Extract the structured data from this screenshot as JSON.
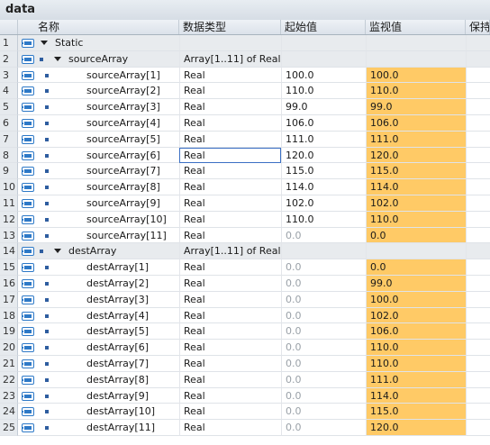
{
  "window": {
    "title": "data"
  },
  "columns": {
    "name": "名称",
    "type": "数据类型",
    "start": "起始值",
    "monitor": "监视值",
    "retain": "保持"
  },
  "rows": [
    {
      "num": "1",
      "name": "Static",
      "level": 0,
      "expand": true,
      "type": "",
      "start": "",
      "monitor": "",
      "grey": true
    },
    {
      "num": "2",
      "name": "sourceArray",
      "level": 1,
      "expand": true,
      "type": "Array[1..11] of Real",
      "start": "",
      "monitor": "",
      "grey": true
    },
    {
      "num": "3",
      "name": "sourceArray[1]",
      "level": 2,
      "type": "Real",
      "start": "100.0",
      "monitor": "100.0"
    },
    {
      "num": "4",
      "name": "sourceArray[2]",
      "level": 2,
      "type": "Real",
      "start": "110.0",
      "monitor": "110.0"
    },
    {
      "num": "5",
      "name": "sourceArray[3]",
      "level": 2,
      "type": "Real",
      "start": "99.0",
      "monitor": "99.0"
    },
    {
      "num": "6",
      "name": "sourceArray[4]",
      "level": 2,
      "type": "Real",
      "start": "106.0",
      "monitor": "106.0"
    },
    {
      "num": "7",
      "name": "sourceArray[5]",
      "level": 2,
      "type": "Real",
      "start": "111.0",
      "monitor": "111.0"
    },
    {
      "num": "8",
      "name": "sourceArray[6]",
      "level": 2,
      "type": "Real",
      "start": "120.0",
      "monitor": "120.0",
      "selected": true
    },
    {
      "num": "9",
      "name": "sourceArray[7]",
      "level": 2,
      "type": "Real",
      "start": "115.0",
      "monitor": "115.0"
    },
    {
      "num": "10",
      "name": "sourceArray[8]",
      "level": 2,
      "type": "Real",
      "start": "114.0",
      "monitor": "114.0"
    },
    {
      "num": "11",
      "name": "sourceArray[9]",
      "level": 2,
      "type": "Real",
      "start": "102.0",
      "monitor": "102.0"
    },
    {
      "num": "12",
      "name": "sourceArray[10]",
      "level": 2,
      "type": "Real",
      "start": "110.0",
      "monitor": "110.0"
    },
    {
      "num": "13",
      "name": "sourceArray[11]",
      "level": 2,
      "type": "Real",
      "start": "0.0",
      "monitor": "0.0",
      "dimStart": true
    },
    {
      "num": "14",
      "name": "destArray",
      "level": 1,
      "expand": true,
      "type": "Array[1..11] of Real",
      "start": "",
      "monitor": "",
      "grey": true
    },
    {
      "num": "15",
      "name": "destArray[1]",
      "level": 2,
      "type": "Real",
      "start": "0.0",
      "monitor": "0.0",
      "dimStart": true
    },
    {
      "num": "16",
      "name": "destArray[2]",
      "level": 2,
      "type": "Real",
      "start": "0.0",
      "monitor": "99.0",
      "dimStart": true
    },
    {
      "num": "17",
      "name": "destArray[3]",
      "level": 2,
      "type": "Real",
      "start": "0.0",
      "monitor": "100.0",
      "dimStart": true
    },
    {
      "num": "18",
      "name": "destArray[4]",
      "level": 2,
      "type": "Real",
      "start": "0.0",
      "monitor": "102.0",
      "dimStart": true
    },
    {
      "num": "19",
      "name": "destArray[5]",
      "level": 2,
      "type": "Real",
      "start": "0.0",
      "monitor": "106.0",
      "dimStart": true
    },
    {
      "num": "20",
      "name": "destArray[6]",
      "level": 2,
      "type": "Real",
      "start": "0.0",
      "monitor": "110.0",
      "dimStart": true
    },
    {
      "num": "21",
      "name": "destArray[7]",
      "level": 2,
      "type": "Real",
      "start": "0.0",
      "monitor": "110.0",
      "dimStart": true
    },
    {
      "num": "22",
      "name": "destArray[8]",
      "level": 2,
      "type": "Real",
      "start": "0.0",
      "monitor": "111.0",
      "dimStart": true
    },
    {
      "num": "23",
      "name": "destArray[9]",
      "level": 2,
      "type": "Real",
      "start": "0.0",
      "monitor": "114.0",
      "dimStart": true
    },
    {
      "num": "24",
      "name": "destArray[10]",
      "level": 2,
      "type": "Real",
      "start": "0.0",
      "monitor": "115.0",
      "dimStart": true
    },
    {
      "num": "25",
      "name": "destArray[11]",
      "level": 2,
      "type": "Real",
      "start": "0.0",
      "monitor": "120.0",
      "dimStart": true
    }
  ],
  "colors": {
    "monitor_highlight": "#ffca66",
    "tag_icon": "#2e79c7",
    "header_bg": "#dbe2ea"
  },
  "icons": {
    "row_tag": "db-tag-icon",
    "bullet": "bullet-icon",
    "expand": "expand-triangle-icon"
  }
}
